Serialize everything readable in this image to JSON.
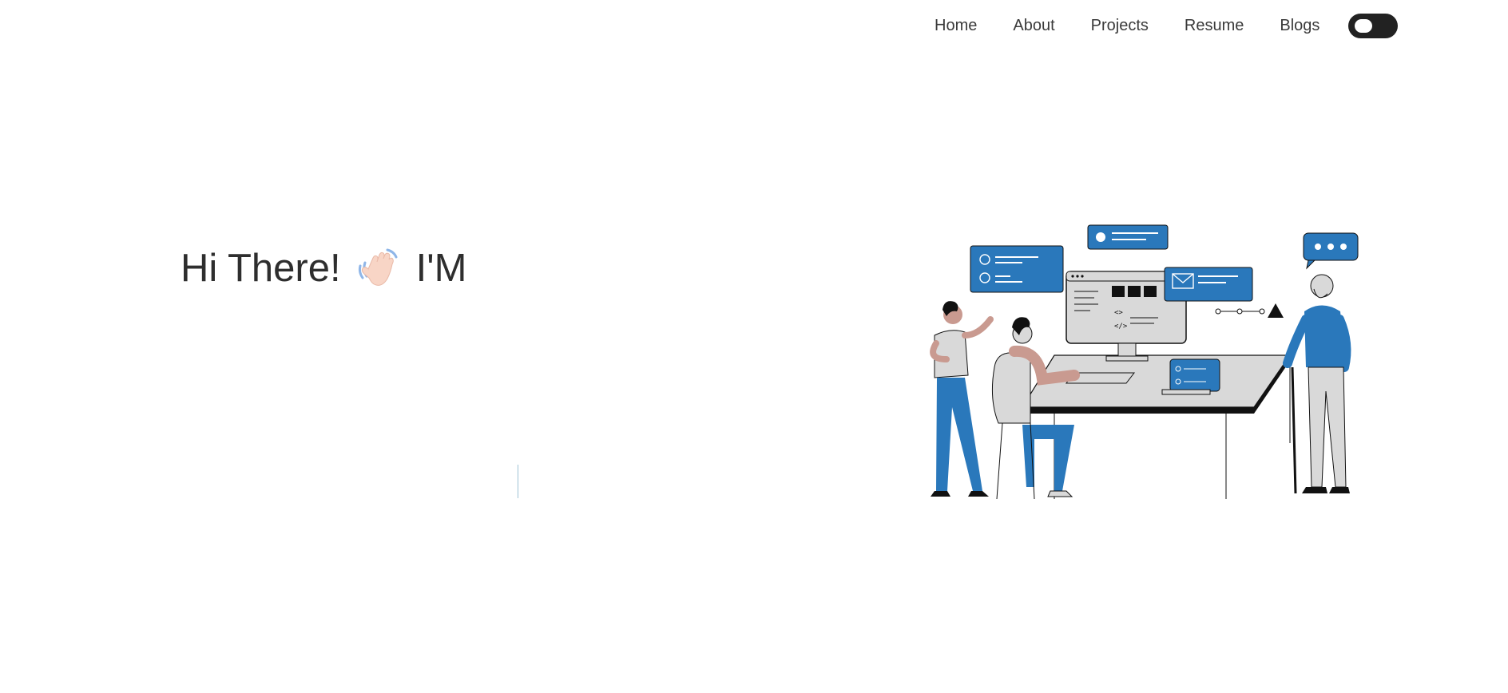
{
  "nav": {
    "items": [
      {
        "label": "Home"
      },
      {
        "label": "About"
      },
      {
        "label": "Projects"
      },
      {
        "label": "Resume"
      },
      {
        "label": "Blogs"
      }
    ],
    "theme_toggle_icon": "toggle-switch-icon"
  },
  "hero": {
    "greeting_prefix": "Hi There!",
    "wave_icon": "waving-hand-icon",
    "greeting_suffix": "I'M",
    "typed_text": ""
  },
  "illustration": {
    "icon": "developers-at-computer-illustration"
  },
  "colors": {
    "accent_blue": "#2a78bb",
    "text_dark": "#2e2e2e",
    "toggle_bg": "#222222",
    "skin": "#c99a90",
    "light_gray": "#d9d9d9"
  }
}
